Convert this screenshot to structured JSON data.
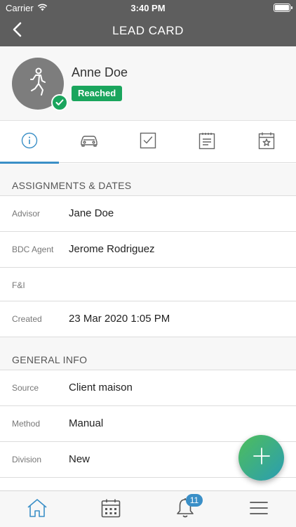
{
  "status_bar": {
    "carrier": "Carrier",
    "time": "3:40 PM"
  },
  "nav": {
    "title": "LEAD CARD",
    "back_icon": "chevron-left-icon"
  },
  "profile": {
    "name": "Anne Doe",
    "status": "Reached",
    "status_color": "#1aa55d"
  },
  "tabs": [
    {
      "icon": "info-icon",
      "active": true
    },
    {
      "icon": "car-icon",
      "active": false
    },
    {
      "icon": "task-check-icon",
      "active": false
    },
    {
      "icon": "notes-icon",
      "active": false
    },
    {
      "icon": "calendar-star-icon",
      "active": false
    }
  ],
  "assignments": {
    "header": "ASSIGNMENTS & DATES",
    "rows": [
      {
        "label": "Advisor",
        "value": "Jane Doe"
      },
      {
        "label": "BDC Agent",
        "value": "Jerome Rodriguez"
      },
      {
        "label": "F&I",
        "value": ""
      },
      {
        "label": "Created",
        "value": "23 Mar 2020 1:05 PM"
      }
    ]
  },
  "general": {
    "header": "GENERAL INFO",
    "rows": [
      {
        "label": "Source",
        "value": "Client maison"
      },
      {
        "label": "Method",
        "value": "Manual"
      },
      {
        "label": "Division",
        "value": "New"
      }
    ]
  },
  "fab": {
    "icon": "plus-icon"
  },
  "bottom_bar": {
    "items": [
      {
        "icon": "home-icon"
      },
      {
        "icon": "calendar-icon"
      },
      {
        "icon": "bell-icon",
        "badge": "11"
      },
      {
        "icon": "menu-icon"
      }
    ]
  },
  "colors": {
    "accent": "#3a8fc7",
    "header_bg": "#5e5e5e",
    "success": "#1aa55d"
  }
}
